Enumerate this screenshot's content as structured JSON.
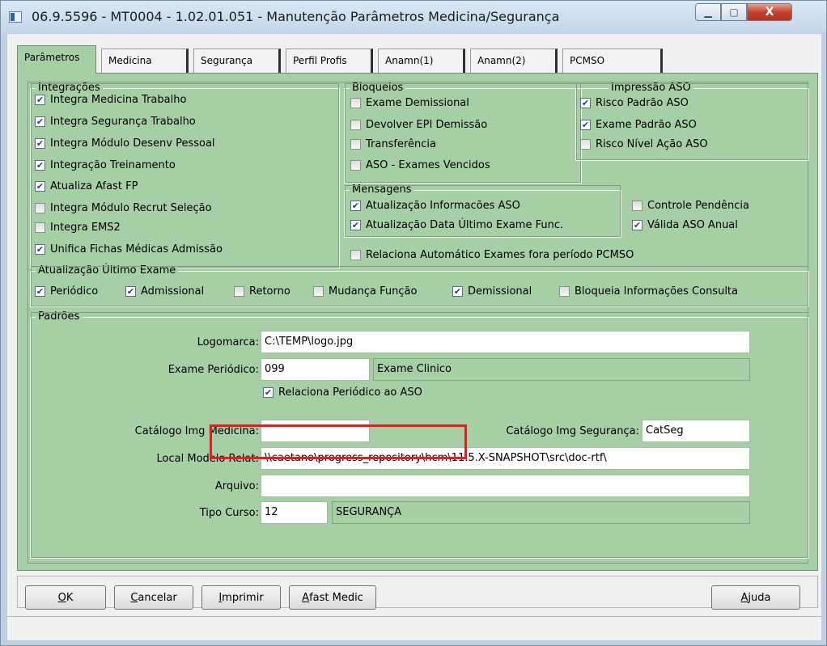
{
  "window": {
    "title": "06.9.5596 - MT0004 - 1.02.01.051 - Manutenção Parâmetros Medicina/Segurança",
    "min_glyph": "▁",
    "max_glyph": "▢",
    "close_glyph": "X"
  },
  "tabs": [
    {
      "label": "Parâmetros",
      "active": true
    },
    {
      "label": "Medicina"
    },
    {
      "label": "Segurança"
    },
    {
      "label": "Perfil Profis"
    },
    {
      "label": "Anamn(1)"
    },
    {
      "label": "Anamn(2)"
    },
    {
      "label": "PCMSO"
    }
  ],
  "integracoes": {
    "title": "Integrações",
    "items": [
      {
        "label": "Integra Medicina Trabalho",
        "checked": true
      },
      {
        "label": "Integra Segurança Trabalho",
        "checked": true
      },
      {
        "label": "Integra Módulo Desenv Pessoal",
        "checked": true
      },
      {
        "label": "Integração Treinamento",
        "checked": true
      },
      {
        "label": "Atualiza Afast FP",
        "checked": true
      },
      {
        "label": "Integra Módulo Recrut Seleção",
        "checked": false
      },
      {
        "label": "Integra EMS2",
        "checked": false
      },
      {
        "label": "Unifica Fichas Médicas Admissão",
        "checked": true
      }
    ]
  },
  "bloqueios": {
    "title": "Bloqueios",
    "items": [
      {
        "label": "Exame Demissional",
        "checked": false
      },
      {
        "label": "Devolver EPI Demissão",
        "checked": false
      },
      {
        "label": "Transferência",
        "checked": false
      },
      {
        "label": "ASO - Exames Vencidos",
        "checked": false
      }
    ]
  },
  "impressao_aso": {
    "title": "Impressão ASO",
    "items": [
      {
        "label": "Risco Padrão ASO",
        "checked": true
      },
      {
        "label": "Exame Padrão ASO",
        "checked": true
      },
      {
        "label": "Risco Nível Ação ASO",
        "checked": false
      }
    ]
  },
  "mensagens": {
    "title": "Mensagens",
    "items": [
      {
        "label": "Atualização Informacões ASO",
        "checked": true
      },
      {
        "label": "Atualização Data Último Exame Func.",
        "checked": true
      }
    ]
  },
  "controle_pendencia": {
    "label": "Controle Pendência",
    "checked": false
  },
  "valida_aso_anual": {
    "label": "Válida ASO Anual",
    "checked": true
  },
  "relaciona_automatico": {
    "label": "Relaciona Automático Exames fora período PCMSO",
    "checked": false
  },
  "atualizacao_ultimo_exame": {
    "title": "Atualização Último Exame",
    "items": [
      {
        "label": "Periódico",
        "checked": true
      },
      {
        "label": "Admissional",
        "checked": true
      },
      {
        "label": "Retorno",
        "checked": false
      },
      {
        "label": "Mudança Função",
        "checked": false
      },
      {
        "label": "Demissional",
        "checked": true
      },
      {
        "label": "Bloqueia Informações Consulta",
        "checked": false
      }
    ]
  },
  "padroes": {
    "title": "Padrões",
    "logomarca_label": "Logomarca:",
    "logomarca_value": "C:\\TEMP\\logo.jpg",
    "exame_periodico_label": "Exame Periódico:",
    "exame_periodico_code": "099",
    "exame_periodico_desc": "Exame Clinico",
    "relaciona_periodico": {
      "label": "Relaciona Periódico ao ASO",
      "checked": true
    },
    "catalogo_medicina_label": "Catálogo Img Medicina:",
    "catalogo_medicina_value": "",
    "catalogo_seguranca_label": "Catálogo Img Segurança:",
    "catalogo_seguranca_value": "CatSeg",
    "local_modelo_label": "Local Modelo Relat:",
    "local_modelo_value": "\\\\caetano\\progress_repository\\hcm\\11.5.X-SNAPSHOT\\src\\doc-rtf\\",
    "arquivo_label": "Arquivo:",
    "arquivo_value": "",
    "tipo_curso_label": "Tipo Curso:",
    "tipo_curso_code": "12",
    "tipo_curso_desc": "SEGURANÇA"
  },
  "buttons": {
    "ok": {
      "key": "O",
      "rest": "K"
    },
    "cancelar": {
      "key": "C",
      "rest": "ancelar"
    },
    "imprimir": {
      "key": "I",
      "rest": "mprimir"
    },
    "afast": {
      "key": "A",
      "rest": "fast Medic"
    },
    "ajuda": {
      "key": "A",
      "rest": "juda"
    }
  }
}
